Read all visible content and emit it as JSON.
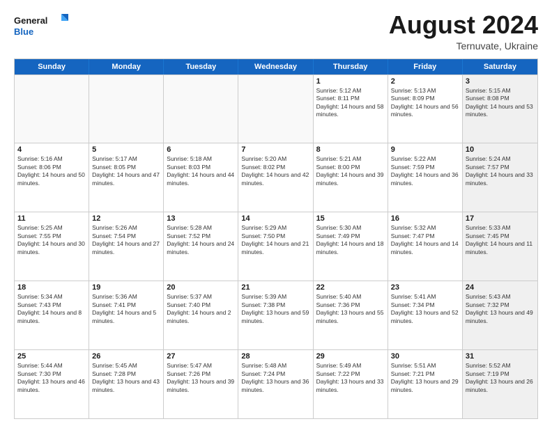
{
  "header": {
    "logo_line1": "General",
    "logo_line2": "Blue",
    "title": "August 2024",
    "subtitle": "Ternuvate, Ukraine"
  },
  "calendar": {
    "days": [
      "Sunday",
      "Monday",
      "Tuesday",
      "Wednesday",
      "Thursday",
      "Friday",
      "Saturday"
    ],
    "rows": [
      [
        {
          "day": "",
          "empty": true
        },
        {
          "day": "",
          "empty": true
        },
        {
          "day": "",
          "empty": true
        },
        {
          "day": "",
          "empty": true
        },
        {
          "day": "1",
          "rise": "5:12 AM",
          "set": "8:11 PM",
          "daylight": "14 hours and 58 minutes."
        },
        {
          "day": "2",
          "rise": "5:13 AM",
          "set": "8:09 PM",
          "daylight": "14 hours and 56 minutes."
        },
        {
          "day": "3",
          "rise": "5:15 AM",
          "set": "8:08 PM",
          "daylight": "14 hours and 53 minutes.",
          "shaded": true
        }
      ],
      [
        {
          "day": "4",
          "rise": "5:16 AM",
          "set": "8:06 PM",
          "daylight": "14 hours and 50 minutes."
        },
        {
          "day": "5",
          "rise": "5:17 AM",
          "set": "8:05 PM",
          "daylight": "14 hours and 47 minutes."
        },
        {
          "day": "6",
          "rise": "5:18 AM",
          "set": "8:03 PM",
          "daylight": "14 hours and 44 minutes."
        },
        {
          "day": "7",
          "rise": "5:20 AM",
          "set": "8:02 PM",
          "daylight": "14 hours and 42 minutes."
        },
        {
          "day": "8",
          "rise": "5:21 AM",
          "set": "8:00 PM",
          "daylight": "14 hours and 39 minutes."
        },
        {
          "day": "9",
          "rise": "5:22 AM",
          "set": "7:59 PM",
          "daylight": "14 hours and 36 minutes."
        },
        {
          "day": "10",
          "rise": "5:24 AM",
          "set": "7:57 PM",
          "daylight": "14 hours and 33 minutes.",
          "shaded": true
        }
      ],
      [
        {
          "day": "11",
          "rise": "5:25 AM",
          "set": "7:55 PM",
          "daylight": "14 hours and 30 minutes."
        },
        {
          "day": "12",
          "rise": "5:26 AM",
          "set": "7:54 PM",
          "daylight": "14 hours and 27 minutes."
        },
        {
          "day": "13",
          "rise": "5:28 AM",
          "set": "7:52 PM",
          "daylight": "14 hours and 24 minutes."
        },
        {
          "day": "14",
          "rise": "5:29 AM",
          "set": "7:50 PM",
          "daylight": "14 hours and 21 minutes."
        },
        {
          "day": "15",
          "rise": "5:30 AM",
          "set": "7:49 PM",
          "daylight": "14 hours and 18 minutes."
        },
        {
          "day": "16",
          "rise": "5:32 AM",
          "set": "7:47 PM",
          "daylight": "14 hours and 14 minutes."
        },
        {
          "day": "17",
          "rise": "5:33 AM",
          "set": "7:45 PM",
          "daylight": "14 hours and 11 minutes.",
          "shaded": true
        }
      ],
      [
        {
          "day": "18",
          "rise": "5:34 AM",
          "set": "7:43 PM",
          "daylight": "14 hours and 8 minutes."
        },
        {
          "day": "19",
          "rise": "5:36 AM",
          "set": "7:41 PM",
          "daylight": "14 hours and 5 minutes."
        },
        {
          "day": "20",
          "rise": "5:37 AM",
          "set": "7:40 PM",
          "daylight": "14 hours and 2 minutes."
        },
        {
          "day": "21",
          "rise": "5:39 AM",
          "set": "7:38 PM",
          "daylight": "13 hours and 59 minutes."
        },
        {
          "day": "22",
          "rise": "5:40 AM",
          "set": "7:36 PM",
          "daylight": "13 hours and 55 minutes."
        },
        {
          "day": "23",
          "rise": "5:41 AM",
          "set": "7:34 PM",
          "daylight": "13 hours and 52 minutes."
        },
        {
          "day": "24",
          "rise": "5:43 AM",
          "set": "7:32 PM",
          "daylight": "13 hours and 49 minutes.",
          "shaded": true
        }
      ],
      [
        {
          "day": "25",
          "rise": "5:44 AM",
          "set": "7:30 PM",
          "daylight": "13 hours and 46 minutes."
        },
        {
          "day": "26",
          "rise": "5:45 AM",
          "set": "7:28 PM",
          "daylight": "13 hours and 43 minutes."
        },
        {
          "day": "27",
          "rise": "5:47 AM",
          "set": "7:26 PM",
          "daylight": "13 hours and 39 minutes."
        },
        {
          "day": "28",
          "rise": "5:48 AM",
          "set": "7:24 PM",
          "daylight": "13 hours and 36 minutes."
        },
        {
          "day": "29",
          "rise": "5:49 AM",
          "set": "7:22 PM",
          "daylight": "13 hours and 33 minutes."
        },
        {
          "day": "30",
          "rise": "5:51 AM",
          "set": "7:21 PM",
          "daylight": "13 hours and 29 minutes."
        },
        {
          "day": "31",
          "rise": "5:52 AM",
          "set": "7:19 PM",
          "daylight": "13 hours and 26 minutes.",
          "shaded": true
        }
      ]
    ]
  }
}
